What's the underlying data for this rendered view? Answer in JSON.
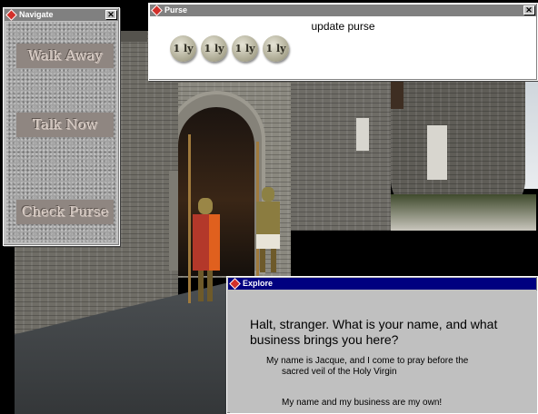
{
  "navigate": {
    "title": "Navigate",
    "buttons": [
      "Walk Away",
      "Talk Now",
      "Check Purse"
    ]
  },
  "purse": {
    "title": "Purse",
    "label": "update purse",
    "coins": [
      "1 ly",
      "1 ly",
      "1 ly",
      "1 ly"
    ]
  },
  "explore": {
    "title": "Explore",
    "npc_line": "Halt, stranger.  What is your name, and what business brings you here?",
    "replies": [
      {
        "line1": "My name is Jacque, and I come to pray before the",
        "line2": "sacred veil of the Holy Virgin"
      },
      {
        "line1": "My name and my business are my own!",
        "line2": ""
      }
    ]
  },
  "colors": {
    "active_titlebar": "#000080",
    "inactive_titlebar": "#808080",
    "window_face": "#c0c0c0",
    "nav_button": "#8f8681"
  },
  "icons": {
    "window": "diamond-app-icon",
    "close": "close-x-icon"
  }
}
